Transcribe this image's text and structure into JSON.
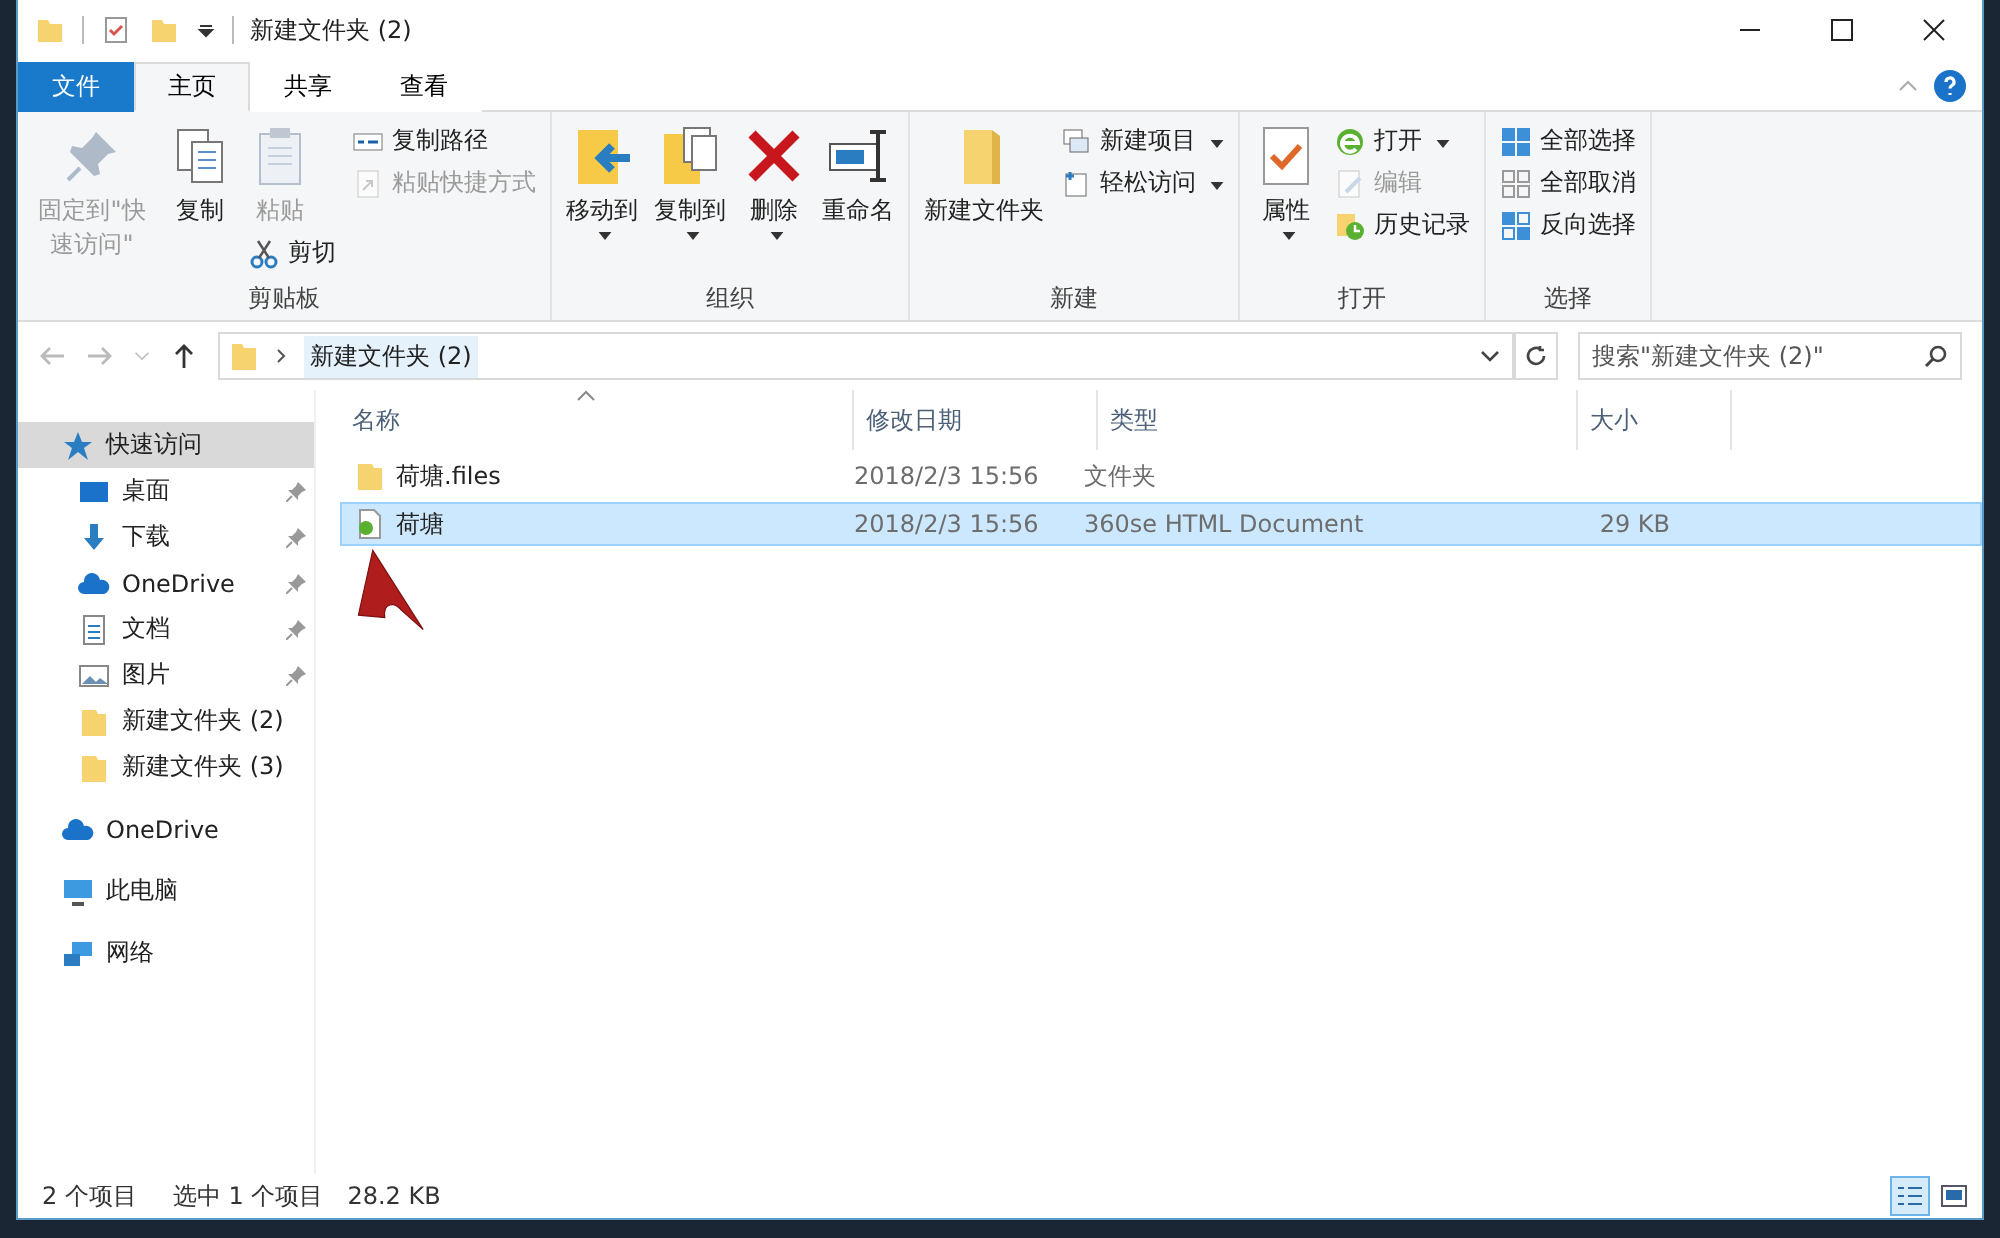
{
  "window": {
    "title": "新建文件夹 (2)"
  },
  "tabs": [
    {
      "label": "文件",
      "kind": "file",
      "selected": false
    },
    {
      "label": "主页",
      "kind": "tab",
      "selected": true
    },
    {
      "label": "共享",
      "kind": "tab",
      "selected": false
    },
    {
      "label": "查看",
      "kind": "tab",
      "selected": false
    }
  ],
  "ribbon": {
    "groups": [
      {
        "label": "剪贴板",
        "columns": [
          [
            {
              "label": "固定到\"快速访问\"",
              "kind": "large",
              "disabled": true,
              "dropdown": false
            }
          ],
          [
            {
              "label": "复制",
              "kind": "large",
              "disabled": false,
              "dropdown": false
            }
          ],
          [
            {
              "label": "粘贴",
              "kind": "large",
              "disabled": true,
              "dropdown": false
            },
            {
              "label": "剪切",
              "kind": "small",
              "disabled": false,
              "dropdown": false
            }
          ],
          [
            {
              "label": "复制路径",
              "kind": "small",
              "disabled": false,
              "dropdown": false
            },
            {
              "label": "粘贴快捷方式",
              "kind": "small",
              "disabled": true,
              "dropdown": false
            }
          ]
        ]
      },
      {
        "label": "组织",
        "columns": [
          [
            {
              "label": "移动到",
              "kind": "large",
              "disabled": false,
              "dropdown": true
            }
          ],
          [
            {
              "label": "复制到",
              "kind": "large",
              "disabled": false,
              "dropdown": true
            }
          ],
          [
            {
              "label": "删除",
              "kind": "large",
              "disabled": false,
              "dropdown": true
            }
          ],
          [
            {
              "label": "重命名",
              "kind": "large",
              "disabled": false,
              "dropdown": false
            }
          ]
        ]
      },
      {
        "label": "新建",
        "columns": [
          [
            {
              "label": "新建文件夹",
              "kind": "large",
              "disabled": false,
              "dropdown": false
            }
          ],
          [
            {
              "label": "新建项目",
              "kind": "small",
              "disabled": false,
              "dropdown": true
            },
            {
              "label": "轻松访问",
              "kind": "small",
              "disabled": false,
              "dropdown": true
            }
          ]
        ]
      },
      {
        "label": "打开",
        "columns": [
          [
            {
              "label": "属性",
              "kind": "large",
              "disabled": false,
              "dropdown": true
            }
          ],
          [
            {
              "label": "打开",
              "kind": "small",
              "disabled": false,
              "dropdown": true
            },
            {
              "label": "编辑",
              "kind": "small",
              "disabled": true,
              "dropdown": false
            },
            {
              "label": "历史记录",
              "kind": "small",
              "disabled": false,
              "dropdown": false
            }
          ]
        ]
      },
      {
        "label": "选择",
        "columns": [
          [
            {
              "label": "全部选择",
              "kind": "small",
              "disabled": false,
              "dropdown": false
            },
            {
              "label": "全部取消",
              "kind": "small",
              "disabled": false,
              "dropdown": false
            },
            {
              "label": "反向选择",
              "kind": "small",
              "disabled": false,
              "dropdown": false
            }
          ]
        ]
      }
    ]
  },
  "address": {
    "path": "新建文件夹 (2)"
  },
  "search": {
    "placeholder": "搜索\"新建文件夹 (2)\""
  },
  "nav": [
    {
      "label": "快速访问",
      "kind": "star",
      "selected": true,
      "children": [
        {
          "label": "桌面",
          "kind": "desktop",
          "pinned": true,
          "selected": false
        },
        {
          "label": "下载",
          "kind": "download",
          "pinned": true,
          "selected": false
        },
        {
          "label": "OneDrive",
          "kind": "cloud",
          "pinned": true,
          "selected": false
        },
        {
          "label": "文档",
          "kind": "doc",
          "pinned": true,
          "selected": false
        },
        {
          "label": "图片",
          "kind": "pictures",
          "pinned": true,
          "selected": false
        },
        {
          "label": "新建文件夹 (2)",
          "kind": "folder",
          "pinned": false,
          "selected": false
        },
        {
          "label": "新建文件夹 (3)",
          "kind": "folder",
          "pinned": false,
          "selected": false
        }
      ]
    },
    {
      "label": "OneDrive",
      "kind": "cloud",
      "selected": false
    },
    {
      "label": "此电脑",
      "kind": "pc",
      "selected": false
    },
    {
      "label": "网络",
      "kind": "network",
      "selected": false
    }
  ],
  "table": {
    "columns": [
      "名称",
      "修改日期",
      "类型",
      "大小"
    ],
    "rows": [
      {
        "kind": "folder",
        "selected": false,
        "cells": [
          "荷塘.files",
          "2018/2/3 15:56",
          "文件夹",
          ""
        ]
      },
      {
        "kind": "html",
        "selected": true,
        "cells": [
          "荷塘",
          "2018/2/3 15:56",
          "360se HTML Document",
          "29 KB"
        ]
      }
    ]
  },
  "status_bar": {
    "count": "2 个项目",
    "selection": "选中 1 个项目",
    "size": "28.2 KB",
    "views": [
      {
        "kind": "details",
        "selected": true
      },
      {
        "kind": "icons",
        "selected": false
      }
    ]
  }
}
